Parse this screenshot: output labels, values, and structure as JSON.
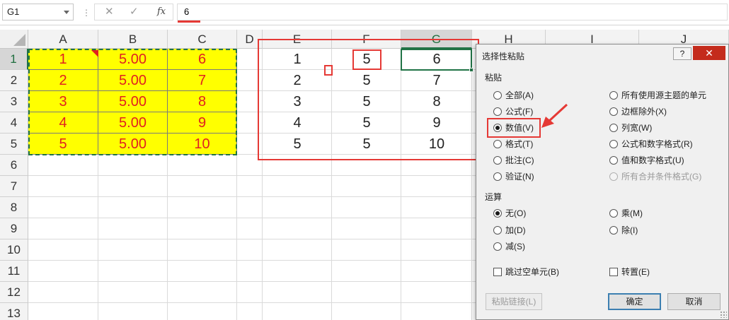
{
  "formula_bar": {
    "name_box": "G1",
    "cancel_icon": "✕",
    "enter_icon": "✓",
    "fx_label": "fx",
    "content": "6"
  },
  "sheet": {
    "columns": [
      "A",
      "B",
      "C",
      "D",
      "E",
      "F",
      "G",
      "H",
      "I",
      "J"
    ],
    "selected_column": "G",
    "rows": [
      "1",
      "2",
      "3",
      "4",
      "5",
      "6",
      "7",
      "8",
      "9",
      "10",
      "11",
      "12",
      "13"
    ],
    "selected_row": "1",
    "colA": [
      "1",
      "2",
      "3",
      "4",
      "5"
    ],
    "colB": [
      "5.00",
      "5.00",
      "5.00",
      "5.00",
      "5.00"
    ],
    "colC": [
      "6",
      "7",
      "8",
      "9",
      "10"
    ],
    "colE": [
      "1",
      "2",
      "3",
      "4",
      "5"
    ],
    "colF": [
      "5",
      "5",
      "5",
      "5",
      "5"
    ],
    "colG": [
      "6",
      "7",
      "8",
      "9",
      "10"
    ],
    "cell_fill": "#ffff00",
    "cell_text_color": "#e02020",
    "annotation_color": "#e53935"
  },
  "dialog": {
    "title": "选择性粘贴",
    "help": "?",
    "close": "✕",
    "paste_section": "粘贴",
    "paste_left": [
      "全部(A)",
      "公式(F)",
      "数值(V)",
      "格式(T)",
      "批注(C)",
      "验证(N)"
    ],
    "paste_right": [
      "所有使用源主题的单元",
      "边框除外(X)",
      "列宽(W)",
      "公式和数字格式(R)",
      "值和数字格式(U)",
      "所有合并条件格式(G)"
    ],
    "selected_paste": "数值(V)",
    "operation_section": "运算",
    "op_left": [
      "无(O)",
      "加(D)",
      "减(S)"
    ],
    "op_right": [
      "乘(M)",
      "除(I)"
    ],
    "selected_op": "无(O)",
    "skip_blanks": "跳过空单元(B)",
    "transpose": "转置(E)",
    "paste_link": "粘贴链接(L)",
    "ok": "确定",
    "cancel": "取消"
  }
}
